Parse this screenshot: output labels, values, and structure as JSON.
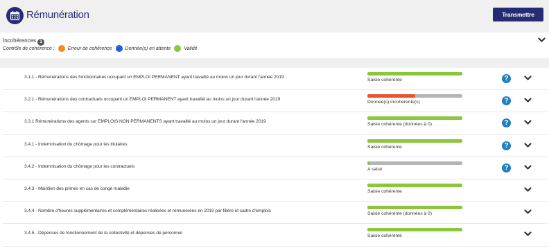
{
  "header": {
    "title": "Rémunération",
    "icon": "calendar-icon",
    "transmit_label": "Transmettre"
  },
  "incoherences": {
    "title": "Incohérences",
    "count": "1",
    "legend_label": "Contrôle de cohérence :",
    "legend": [
      {
        "label": "Erreur de cohérence",
        "color": "#f28c1a"
      },
      {
        "label": "Donnée(s) en attente",
        "color": "#1f5fe0"
      },
      {
        "label": "Validé",
        "color": "#8cc63f"
      }
    ]
  },
  "colors": {
    "primary": "#262c73",
    "ok": "#8cc63f",
    "error": "#e8542a",
    "empty": "#b5b5b5",
    "help": "#1f7fc0"
  },
  "items": [
    {
      "label": "3.1.1 - Rémunérations des fonctionnaires occupant un EMPLOI PERMANENT ayant travaillé au moins un jour durant l'année 2019",
      "status": "Saisie cohérente",
      "progress": 1.0,
      "bar_color": "#8cc63f",
      "help": true
    },
    {
      "label": "3.2.1 - Rémunérations des contractuels occupant un EMPLOI PERMANENT ayant travaillé au moins un jour durant l'année 2019",
      "status": "Donnée(s) incohérente(s)",
      "progress": 0.5,
      "bar_color": "#e8542a",
      "help": true
    },
    {
      "label": "3.3.1 Rémunérations des agents sur EMPLOIS NON PERMANENTS ayant travaillé au moins un jour durant l'année 2019",
      "status": "Saisie cohérente (données à 0)",
      "progress": 1.0,
      "bar_color": "#8cc63f",
      "help": true
    },
    {
      "label": "3.4.1 - Indemnisation du chômage pour les titulaires",
      "status": "Saisie cohérente",
      "progress": 1.0,
      "bar_color": "#8cc63f",
      "help": true
    },
    {
      "label": "3.4.2 - Indemnisation du chômage pour les contractuels",
      "status": "A saisir",
      "progress": 0.03,
      "bar_color": "#8cc63f",
      "help": true
    },
    {
      "label": "3.4.3 - Maintien des primes en cas de congé maladie",
      "status": "Saisie cohérente",
      "progress": 1.0,
      "bar_color": "#8cc63f",
      "help": false
    },
    {
      "label": "3.4.4 - Nombre d'heures supplémentaires et complémentaires réalisées et rémunérées en 2019 par filière et cadre d'emplois",
      "status": "Saisie cohérente (données à 0)",
      "progress": 1.0,
      "bar_color": "#8cc63f",
      "help": false
    },
    {
      "label": "3.4.5 - Dépenses de fonctionnement de la collectivité et dépenses de personnel",
      "status": "Saisie cohérente",
      "progress": 1.0,
      "bar_color": "#8cc63f",
      "help": false
    }
  ]
}
